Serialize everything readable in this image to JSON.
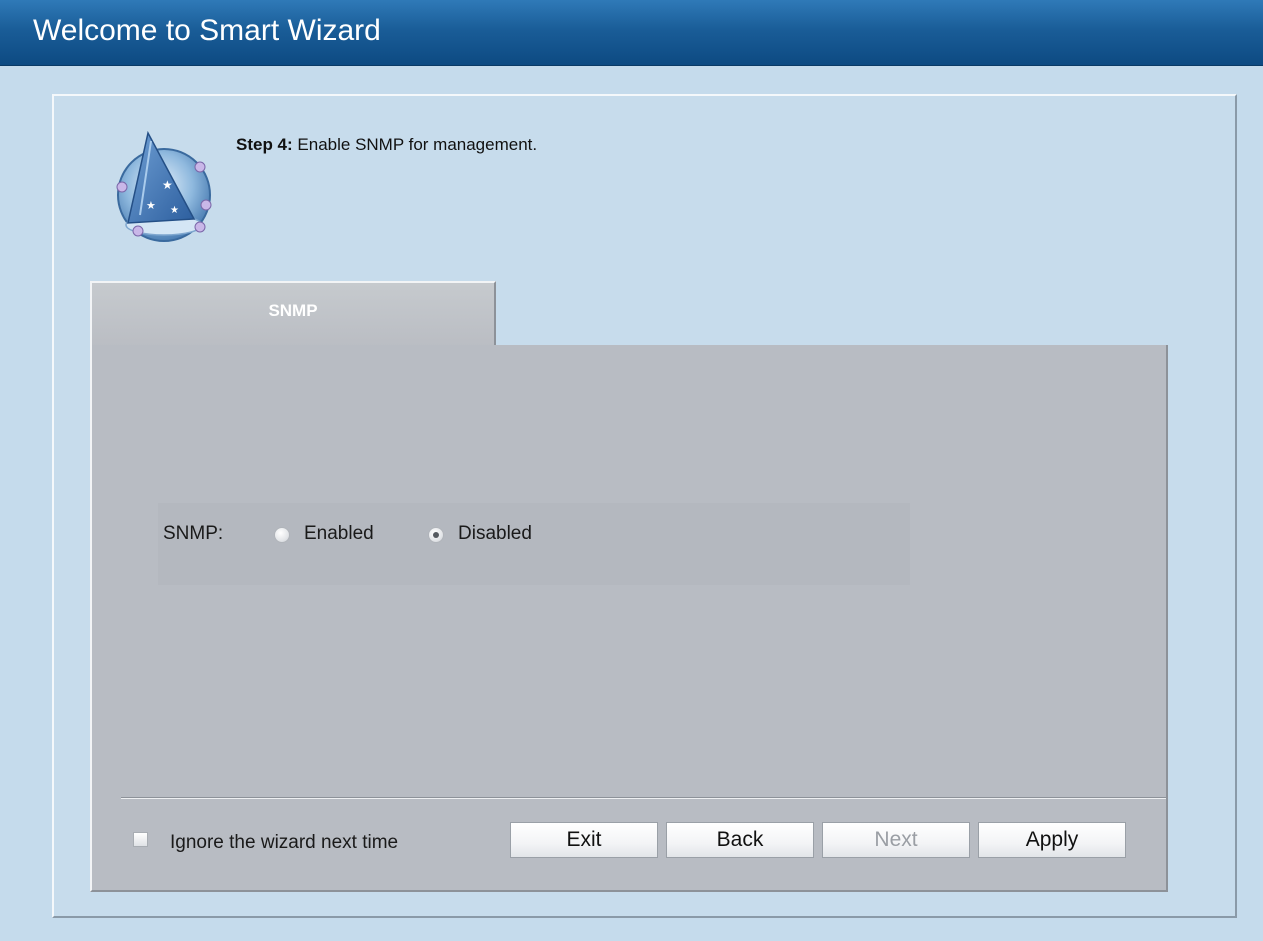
{
  "window": {
    "title": "Welcome to Smart Wizard"
  },
  "step": {
    "number_label": "Step 4:",
    "description": " Enable SNMP for management."
  },
  "tab": {
    "label": "SNMP"
  },
  "snmp": {
    "label": "SNMP:",
    "options": [
      {
        "label": "Enabled",
        "selected": false
      },
      {
        "label": "Disabled",
        "selected": true
      }
    ]
  },
  "footer": {
    "ignore_label": "Ignore the wizard next time",
    "ignore_checked": false,
    "buttons": {
      "exit": "Exit",
      "back": "Back",
      "next": "Next",
      "apply": "Apply"
    }
  },
  "colors": {
    "title_bar": "#1a5d98",
    "background": "#c5dbec",
    "panel": "#b8bcc3"
  },
  "icons": {
    "wizard": "wizard-hat-icon"
  }
}
